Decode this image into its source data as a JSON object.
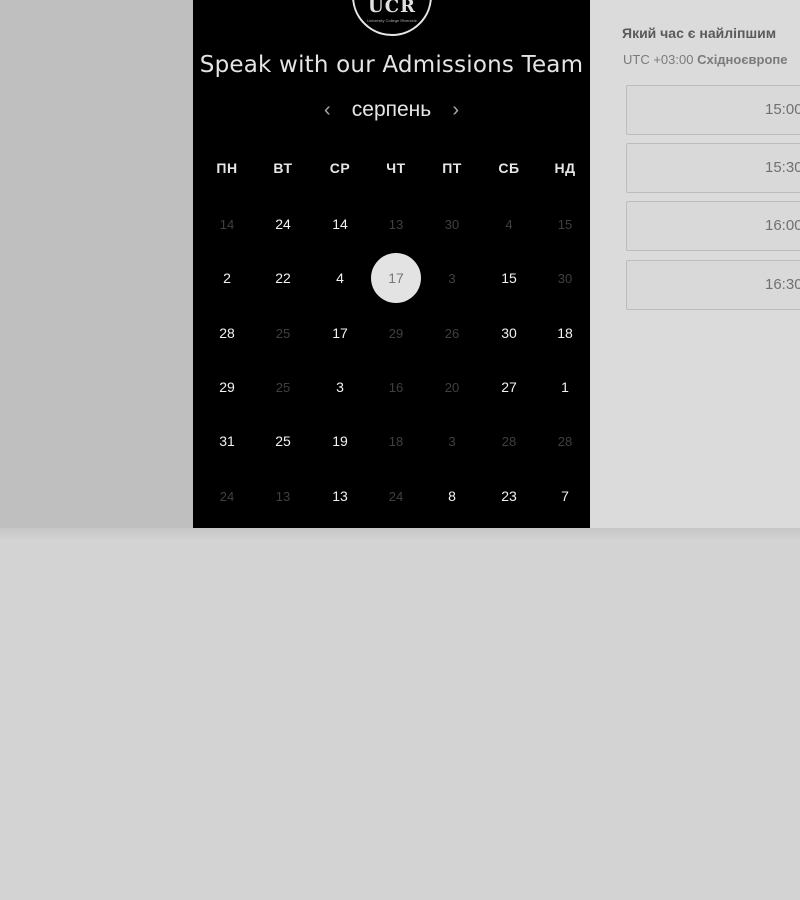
{
  "brand": {
    "logo_text": "UCR",
    "logo_subtext": "University College Riverside"
  },
  "calendar": {
    "title": "Speak with our Admissions Team",
    "month": "серпень",
    "prev_icon": "chevron-left-icon",
    "next_icon": "chevron-right-icon",
    "weekdays": [
      "ПН",
      "ВТ",
      "СР",
      "ЧТ",
      "ПТ",
      "СБ",
      "НД"
    ],
    "weeks": [
      [
        {
          "d": "14",
          "on": false
        },
        {
          "d": "24",
          "on": true
        },
        {
          "d": "14",
          "on": true
        },
        {
          "d": "13",
          "on": false
        },
        {
          "d": "30",
          "on": false
        },
        {
          "d": "4",
          "on": false
        },
        {
          "d": "15",
          "on": false
        }
      ],
      [
        {
          "d": "2",
          "on": true
        },
        {
          "d": "22",
          "on": true
        },
        {
          "d": "4",
          "on": true
        },
        {
          "d": "17",
          "on": true,
          "selected": true
        },
        {
          "d": "3",
          "on": false
        },
        {
          "d": "15",
          "on": true
        },
        {
          "d": "30",
          "on": false
        }
      ],
      [
        {
          "d": "28",
          "on": true
        },
        {
          "d": "25",
          "on": false
        },
        {
          "d": "17",
          "on": true
        },
        {
          "d": "29",
          "on": false
        },
        {
          "d": "26",
          "on": false
        },
        {
          "d": "30",
          "on": true
        },
        {
          "d": "18",
          "on": true
        }
      ],
      [
        {
          "d": "29",
          "on": true
        },
        {
          "d": "25",
          "on": false
        },
        {
          "d": "3",
          "on": true
        },
        {
          "d": "16",
          "on": false
        },
        {
          "d": "20",
          "on": false
        },
        {
          "d": "27",
          "on": true
        },
        {
          "d": "1",
          "on": true
        }
      ],
      [
        {
          "d": "31",
          "on": true
        },
        {
          "d": "25",
          "on": true
        },
        {
          "d": "19",
          "on": true
        },
        {
          "d": "18",
          "on": false
        },
        {
          "d": "3",
          "on": false
        },
        {
          "d": "28",
          "on": false
        },
        {
          "d": "28",
          "on": false
        }
      ],
      [
        {
          "d": "24",
          "on": false
        },
        {
          "d": "13",
          "on": false
        },
        {
          "d": "13",
          "on": true
        },
        {
          "d": "24",
          "on": false
        },
        {
          "d": "8",
          "on": true
        },
        {
          "d": "23",
          "on": true
        },
        {
          "d": "7",
          "on": true
        }
      ]
    ]
  },
  "times": {
    "question": "Який час є найліпшим",
    "timezone_offset": "UTC +03:00",
    "timezone_name": "Східноєвропе",
    "slots": [
      "15:00",
      "15:30",
      "16:00",
      "16:30"
    ]
  },
  "colors": {
    "calendar_bg": "#000000",
    "selected_day_bg": "#e3e3e3",
    "page_bg": "#d3d3d3"
  }
}
